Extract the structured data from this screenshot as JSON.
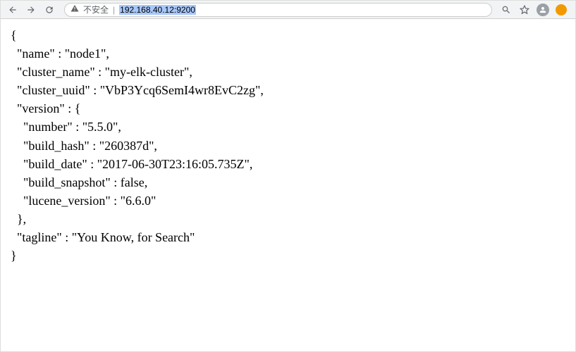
{
  "toolbar": {
    "insecure_label": "不安全",
    "url": "192.168.40.12:9200"
  },
  "response": {
    "name": "node1",
    "cluster_name": "my-elk-cluster",
    "cluster_uuid": "VbP3Ycq6SemI4wr8EvC2zg",
    "version": {
      "number": "5.5.0",
      "build_hash": "260387d",
      "build_date": "2017-06-30T23:16:05.735Z",
      "build_snapshot": "false",
      "lucene_version": "6.6.0"
    },
    "tagline": "You Know, for Search"
  }
}
